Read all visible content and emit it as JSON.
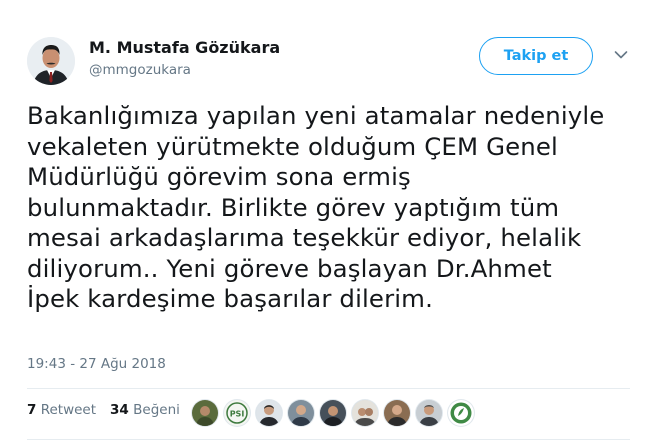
{
  "author": {
    "name": "M. Mustafa Gözükara",
    "handle": "@mmgozukara"
  },
  "follow_label": "Takip et",
  "tweet_lines": [
    "Bakanlığımıza yapılan yeni atamalar nedeniyle",
    "vekaleten yürütmekte olduğum ÇEM Genel",
    "Müdürlüğü görevim sona ermiş",
    "bulunmaktadır. Birlikte görev yaptığım tüm",
    "mesai arkadaşlarıma teşekkür ediyor, helalik",
    "diliyorum.. Yeni göreve başlayan Dr.Ahmet",
    "İpek kardeşime başarılar dilerim."
  ],
  "timestamp": "19:43 - 27 Ağu 2018",
  "stats": {
    "retweets": "7",
    "retweet_label": "Retweet",
    "likes": "34",
    "like_label": "Beğeni"
  },
  "liker_avatars": [
    "avatar-photo",
    "avatar-logo",
    "avatar-photo",
    "avatar-photo",
    "avatar-photo",
    "avatar-photo",
    "avatar-photo",
    "avatar-photo",
    "avatar-logo"
  ],
  "colors": {
    "accent": "#1da1f2",
    "secondary_text": "#657786",
    "primary_text": "#14171a",
    "divider": "#e6ecf0"
  }
}
